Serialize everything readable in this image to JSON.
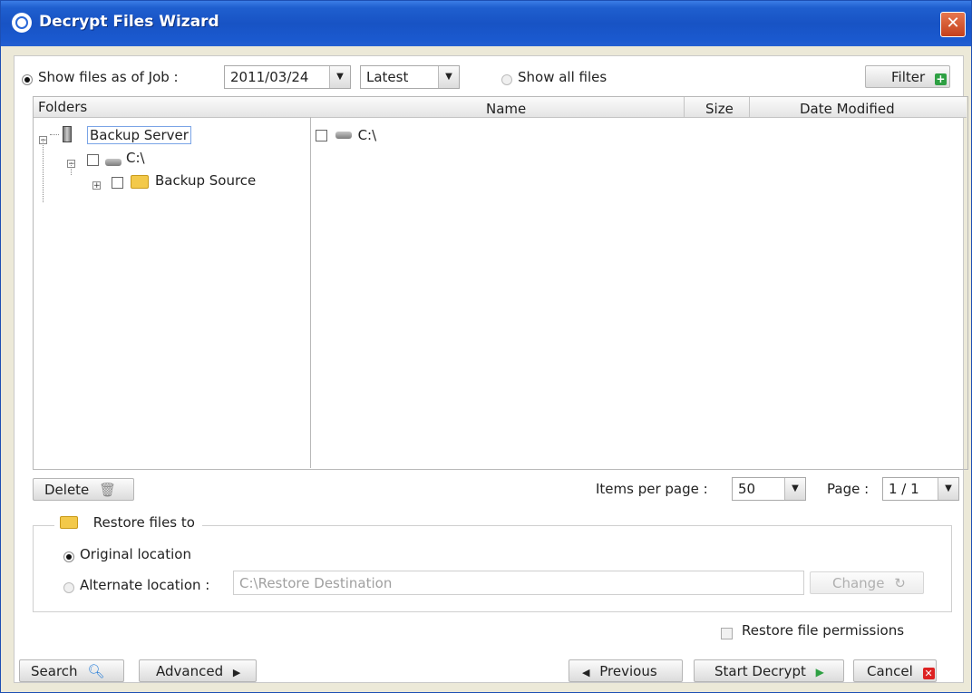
{
  "window": {
    "title": "Decrypt Files Wizard"
  },
  "toolbar": {
    "show_as_of_job_label": "Show files as of Job :",
    "job_date": "2011/03/24",
    "job_version": "Latest",
    "show_all_label": "Show all files",
    "filter_label": "Filter"
  },
  "folders": {
    "header": "Folders",
    "tree": {
      "root": "Backup Server",
      "drive": "C:\\",
      "child": "Backup Source"
    }
  },
  "files": {
    "columns": {
      "name": "Name",
      "size": "Size",
      "date": "Date Modified"
    },
    "rows": [
      {
        "name": "C:\\"
      }
    ]
  },
  "actions": {
    "delete_label": "Delete",
    "items_per_page_label": "Items per page :",
    "items_per_page": "50",
    "page_label": "Page :",
    "page_value": "1 / 1"
  },
  "restore": {
    "title": "Restore files to",
    "original_label": "Original location",
    "alternate_label": "Alternate location :",
    "alternate_placeholder": "C:\\Restore Destination",
    "change_label": "Change",
    "permissions_label": "Restore file permissions"
  },
  "footer": {
    "search_label": "Search",
    "advanced_label": "Advanced",
    "previous_label": "Previous",
    "start_label": "Start Decrypt",
    "cancel_label": "Cancel"
  },
  "colors": {
    "titlebar": "#1853c4",
    "accent_green": "#2ea043",
    "cancel_red": "#dd2222"
  }
}
